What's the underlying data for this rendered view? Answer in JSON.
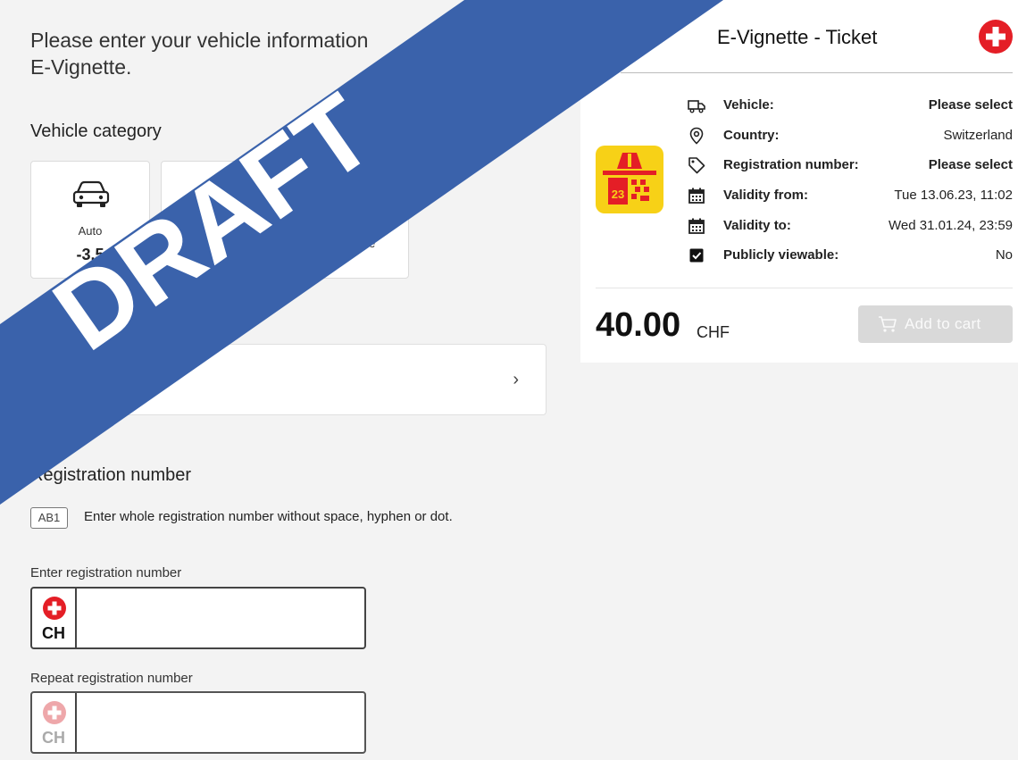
{
  "intro": {
    "line1": "Please enter your vehicle information",
    "line2": "E-Vignette."
  },
  "category": {
    "title": "Vehicle category",
    "auto_label": "Auto",
    "auto_sub": "-3.5",
    "fragment_right": "e"
  },
  "registration": {
    "title": "Registration number",
    "badge": "AB1",
    "hint": "Enter whole registration number without space, hyphen or dot.",
    "enter_label": "Enter registration number",
    "repeat_label": "Repeat registration number",
    "country_code": "CH",
    "enter_value": "",
    "repeat_value": ""
  },
  "ticket": {
    "title": "E-Vignette - Ticket",
    "logo_number": "23",
    "rows": [
      {
        "key": "Vehicle:",
        "value": "Please select",
        "icon": "truck-icon"
      },
      {
        "key": "Country:",
        "value": "Switzerland",
        "icon": "location-pin-icon"
      },
      {
        "key": "Registration number:",
        "value": "Please select",
        "icon": "tag-icon"
      },
      {
        "key": "Validity from:",
        "value": "Tue 13.06.23, 11:02",
        "icon": "calendar-icon"
      },
      {
        "key": "Validity to:",
        "value": "Wed 31.01.24, 23:59",
        "icon": "calendar-icon"
      },
      {
        "key": "Publicly viewable:",
        "value": "No",
        "icon": "checkbox-icon"
      }
    ],
    "price": "40.00",
    "currency": "CHF",
    "cart_label": "Add to cart"
  },
  "ribbon": {
    "text": "DRAFT",
    "color": "#3a62ab"
  },
  "colors": {
    "swiss_red": "#e41e26",
    "vignette_yellow": "#f7d117"
  }
}
